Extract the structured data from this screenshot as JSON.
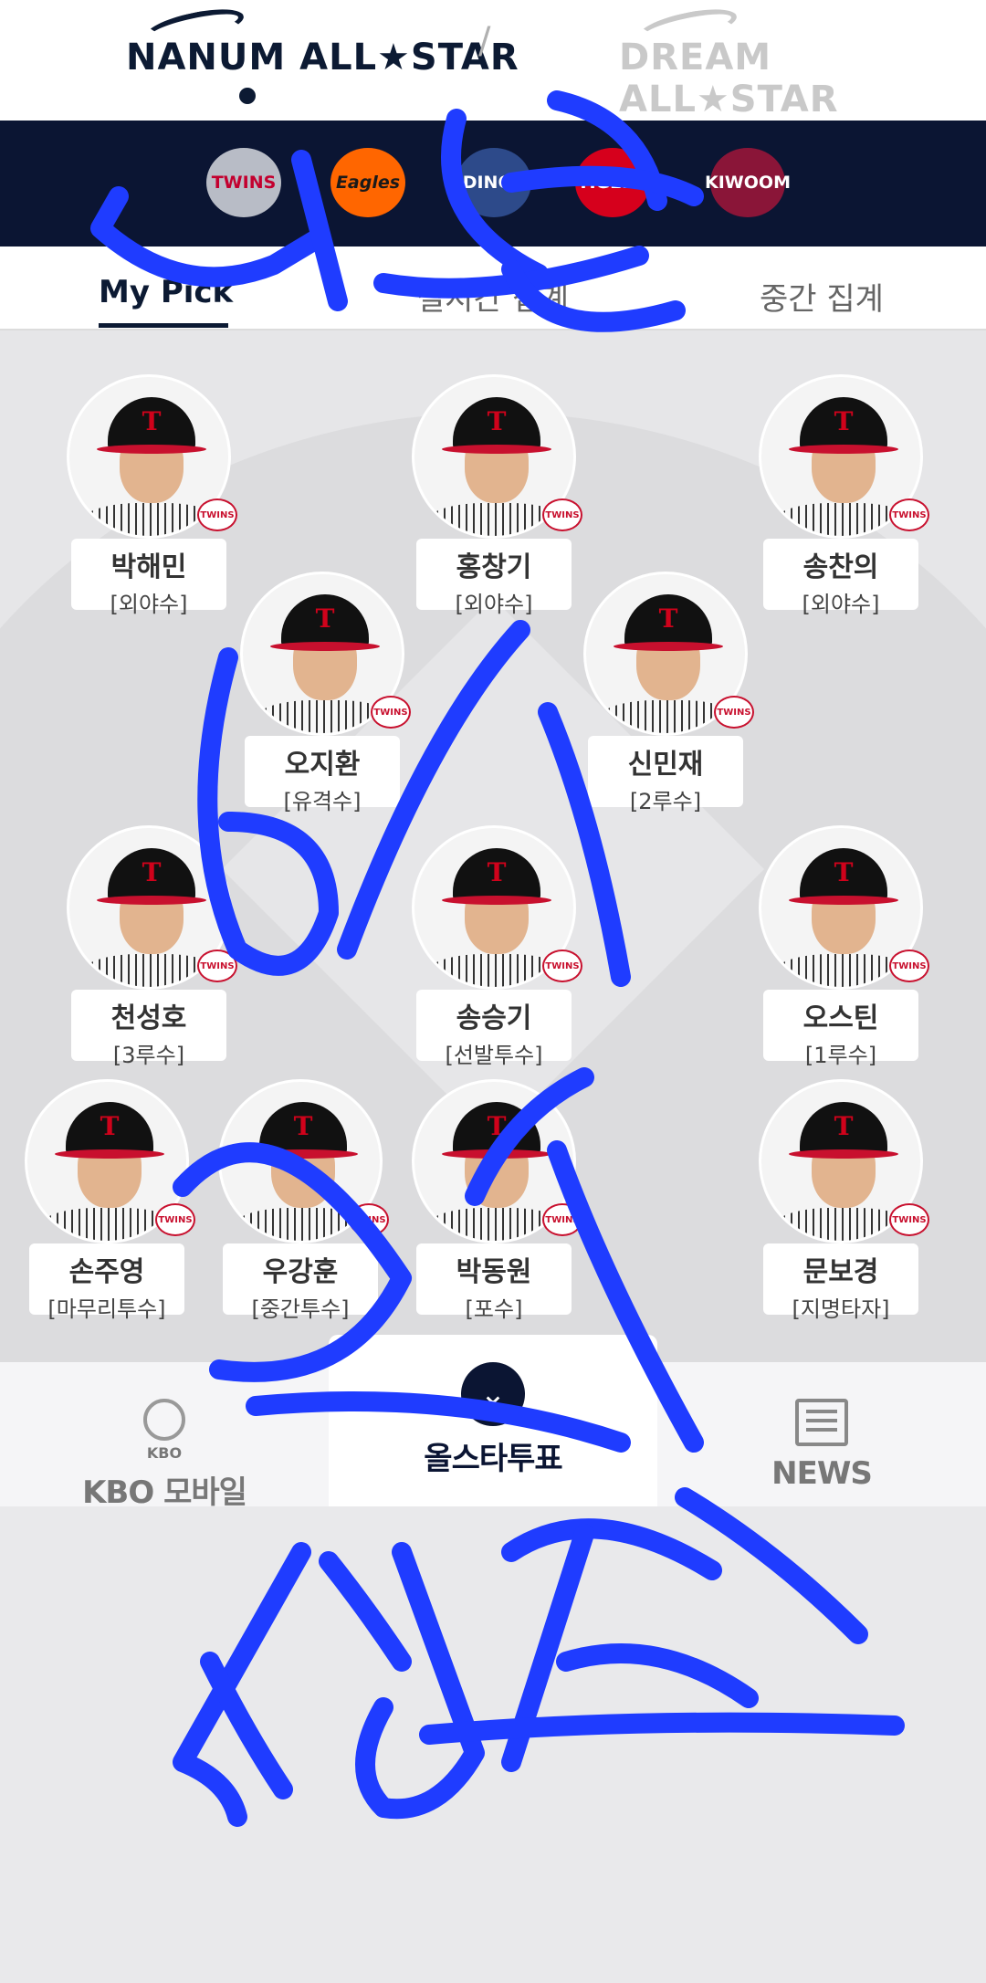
{
  "leagues": {
    "nanum": "NANUM ALL★STAR",
    "separator": "/",
    "dream": "DREAM ALL★STAR"
  },
  "teams": [
    "TWINS",
    "Eagles",
    "DINOS",
    "TIGERS",
    "KIWOOM"
  ],
  "tabs": [
    "My Pick",
    "실시간 집계",
    "중간 집계"
  ],
  "badge_text": "TWINS",
  "cap_letter": "T",
  "players": [
    {
      "name": "박해민",
      "position": "[외야수]"
    },
    {
      "name": "홍창기",
      "position": "[외야수]"
    },
    {
      "name": "송찬의",
      "position": "[외야수]"
    },
    {
      "name": "오지환",
      "position": "[유격수]"
    },
    {
      "name": "신민재",
      "position": "[2루수]"
    },
    {
      "name": "천성호",
      "position": "[3루수]"
    },
    {
      "name": "송승기",
      "position": "[선발투수]"
    },
    {
      "name": "오스틴",
      "position": "[1루수]"
    },
    {
      "name": "손주영",
      "position": "[마무리투수]"
    },
    {
      "name": "우강훈",
      "position": "[중간투수]"
    },
    {
      "name": "박동원",
      "position": "[포수]"
    },
    {
      "name": "문보경",
      "position": "[지명타자]"
    }
  ],
  "nav": {
    "kbo_sub": "KBO",
    "kbo_label": "KBO 모바일",
    "vote_label": "올스타투표",
    "news_label": "NEWS"
  },
  "colors": {
    "navy": "#0b1533",
    "twins_red": "#c8102e",
    "scribble_blue": "#1f3cff"
  }
}
